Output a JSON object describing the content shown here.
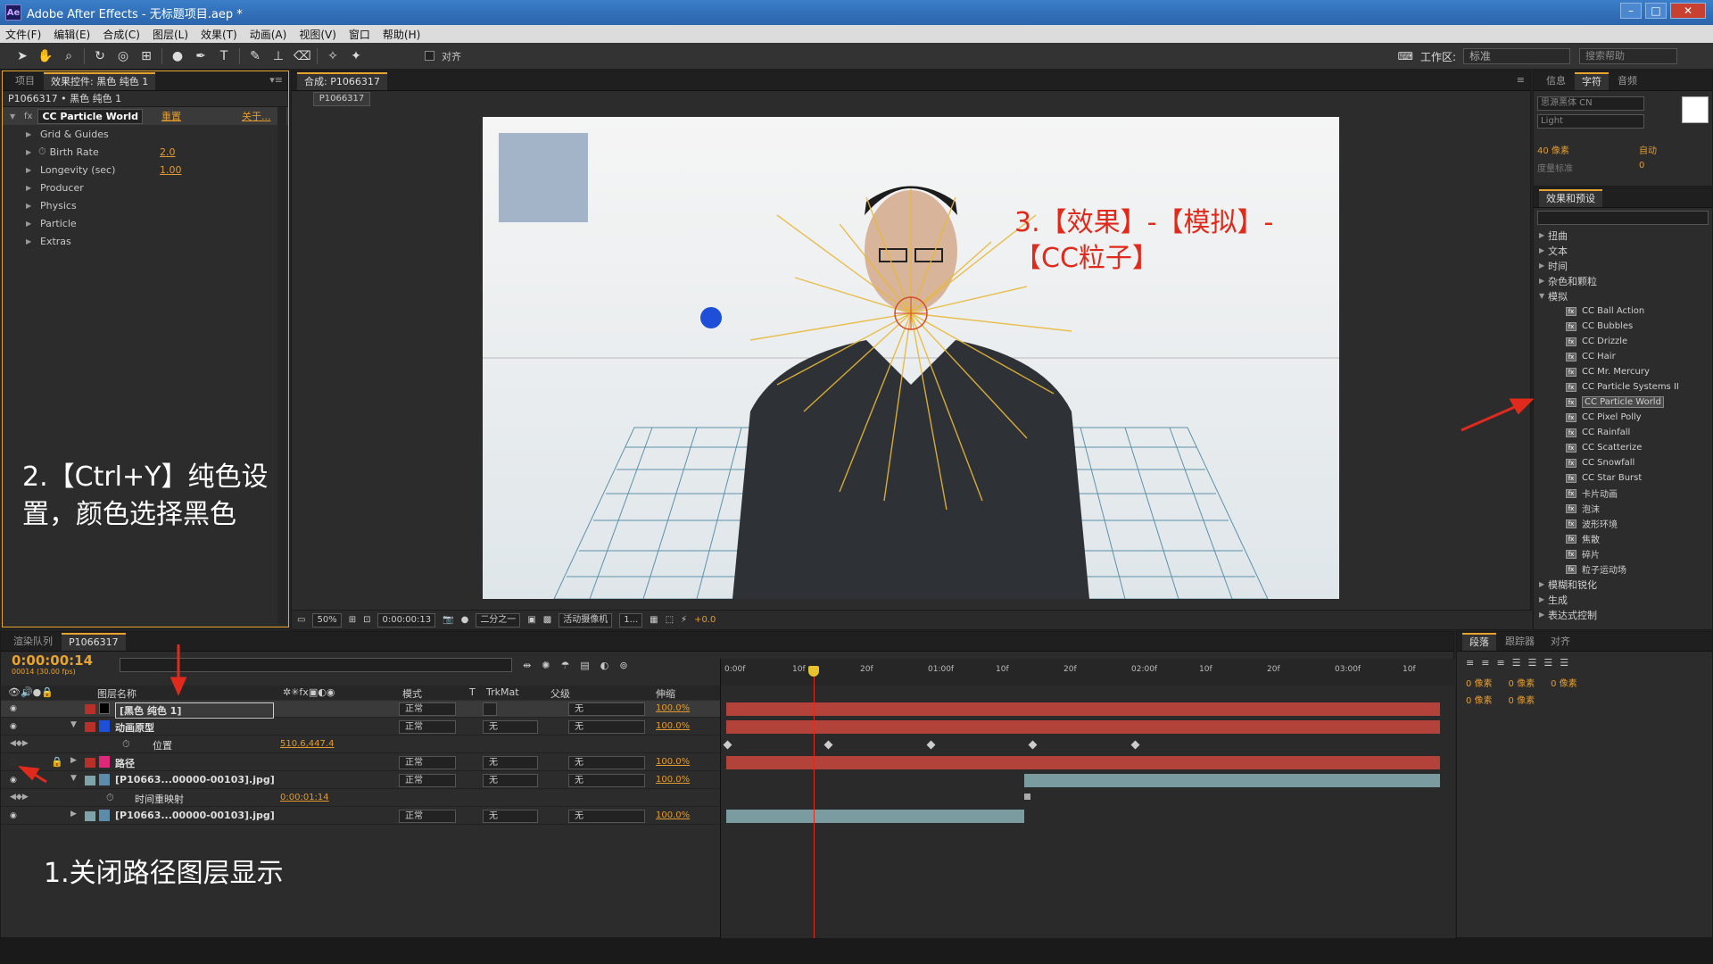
{
  "window": {
    "title": "Adobe After Effects - 无标题项目.aep *",
    "app_icon": "Ae"
  },
  "menu": [
    "文件(F)",
    "编辑(E)",
    "合成(C)",
    "图层(L)",
    "效果(T)",
    "动画(A)",
    "视图(V)",
    "窗口",
    "帮助(H)"
  ],
  "toolbar": {
    "align_label": "对齐",
    "workspace_label": "工作区:",
    "workspace_value": "标准",
    "search_help_placeholder": "搜索帮助"
  },
  "effect_panel": {
    "tabs": [
      "项目",
      "效果控件: 黑色 纯色 1"
    ],
    "breadcrumb": "P1066317 • 黑色 纯色 1",
    "effect_name": "CC Particle World",
    "reset_label": "重置",
    "about_label": "关于...",
    "properties": [
      {
        "label": "Grid & Guides",
        "value": ""
      },
      {
        "label": "Birth Rate",
        "value": "2.0"
      },
      {
        "label": "Longevity (sec)",
        "value": "1.00"
      },
      {
        "label": "Producer",
        "value": ""
      },
      {
        "label": "Physics",
        "value": ""
      },
      {
        "label": "Particle",
        "value": ""
      },
      {
        "label": "Extras",
        "value": ""
      }
    ],
    "annotation": "2.【Ctrl+Y】纯色设置，颜色选择黑色"
  },
  "composition": {
    "tab": "合成: P1066317",
    "sub_tab": "P1066317",
    "zoom": "50%",
    "timecode": "0:00:00:13",
    "resolution": "二分之一",
    "camera": "活动摄像机",
    "views": "1...",
    "exposure": "+0.0",
    "annotation": "3.【效果】-【模拟】-【CC粒子】"
  },
  "character_panel": {
    "tabs": [
      "信息",
      "字符",
      "音频"
    ],
    "font_family": "思源黑体 CN",
    "font_style": "Light",
    "font_size": "40 像素",
    "leading": "自动",
    "kerning": "度量标准",
    "tracking": "0"
  },
  "effects_presets": {
    "tab": "效果和预设",
    "categories_before": [
      "扭曲",
      "文本",
      "时间",
      "杂色和颗粒"
    ],
    "open_category": "模拟",
    "items": [
      "CC Ball Action",
      "CC Bubbles",
      "CC Drizzle",
      "CC Hair",
      "CC Mr. Mercury",
      "CC Particle Systems II",
      "CC Particle World",
      "CC Pixel Polly",
      "CC Rainfall",
      "CC Scatterize",
      "CC Snowfall",
      "CC Star Burst",
      "卡片动画",
      "泡沫",
      "波形环境",
      "焦散",
      "碎片",
      "粒子运动场"
    ],
    "selected_item": "CC Particle World",
    "categories_after": [
      "模糊和锐化",
      "生成",
      "表达式控制"
    ]
  },
  "timeline": {
    "tabs": [
      "渲染队列",
      "P1066317"
    ],
    "current_time": "0:00:00:14",
    "frame_info": "00014 (30.00 fps)",
    "columns": {
      "layer_name": "图层名称",
      "mode": "模式",
      "t": "T",
      "trkmat": "TrkMat",
      "parent": "父级",
      "stretch": "伸缩"
    },
    "layers": [
      {
        "name": "[黑色 纯色 1]",
        "mode": "正常",
        "trkmat": "",
        "parent": "无",
        "stretch": "100.0%",
        "color": "#b8302a"
      },
      {
        "name": "动画原型",
        "mode": "正常",
        "trkmat": "无",
        "parent": "无",
        "stretch": "100.0%",
        "color": "#1e4fd8"
      },
      {
        "name": "位置",
        "value": "510.6,447.4"
      },
      {
        "name": "路径",
        "mode": "正常",
        "trkmat": "无",
        "parent": "无",
        "stretch": "100.0%",
        "color": "#e0287a"
      },
      {
        "name": "[P10663...00000-00103].jpg]",
        "mode": "正常",
        "trkmat": "无",
        "parent": "无",
        "stretch": "100.0%",
        "color": "#7fa3a8"
      },
      {
        "name": "时间重映射",
        "value": "0:00:01:14"
      },
      {
        "name": "[P10663...00000-00103].jpg]",
        "mode": "正常",
        "trkmat": "无",
        "parent": "无",
        "stretch": "100.0%",
        "color": "#7fa3a8"
      }
    ],
    "ruler_ticks": [
      "0:00f",
      "10f",
      "20f",
      "01:00f",
      "10f",
      "20f",
      "02:00f",
      "10f",
      "20f",
      "03:00f",
      "10f"
    ],
    "annotation": "1.关闭路径图层显示"
  },
  "paragraph_panel": {
    "tabs": [
      "段落",
      "跟踪器",
      "对齐"
    ],
    "indent_values": [
      "0 像素",
      "0 像素",
      "0 像素",
      "0 像素",
      "0 像素"
    ]
  },
  "colors": {
    "accent_orange": "#e8a22e",
    "annotation_red": "#e02a1c",
    "title_blue": "#2a64ab"
  }
}
